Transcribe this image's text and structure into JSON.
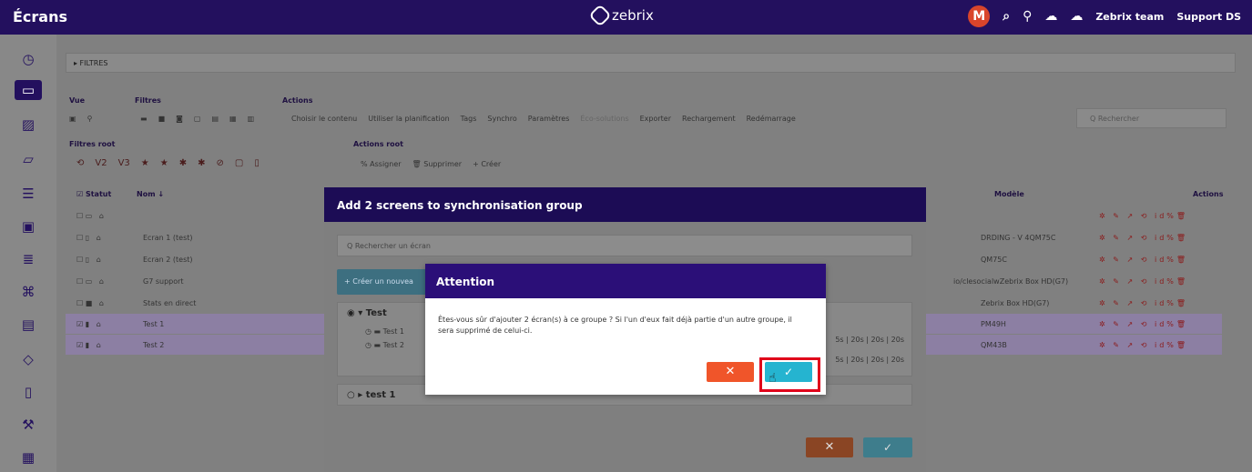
{
  "topbar": {
    "title": "Écrans",
    "brand": "zebrix",
    "avatar_letter": "M",
    "team": "Zebrix team",
    "support": "Support DS"
  },
  "main": {
    "filters_label": "▸ FILTRES",
    "vue_label": "Vue",
    "filtres_label": "Filtres",
    "actions_label": "Actions",
    "actions": [
      "Choisir le contenu",
      "Utiliser la planification",
      "Tags",
      "Synchro",
      "Paramètres",
      "Éco-solutions",
      "Exporter",
      "Rechargement",
      "Redémarrage"
    ],
    "search_placeholder": "Q  Rechercher",
    "filtres_root_label": "Filtres root",
    "filtres_root_items": [
      "⟲",
      "V2",
      "V3",
      "★",
      "★",
      "✱",
      "✱",
      "⊘",
      "▢",
      "▯"
    ],
    "actions_root_label": "Actions root",
    "actions_root": [
      "% Assigner",
      "🗑 Supprimer",
      "+ Créer"
    ],
    "col_statut": "Statut",
    "col_nom": "Nom ↓",
    "col_modele": "Modèle",
    "col_actions": "Actions",
    "rows": [
      {
        "name": "",
        "model": ""
      },
      {
        "name": "Ecran 1 (test)",
        "model": "DRDING - V 4QM75C"
      },
      {
        "name": "Ecran 2 (test)",
        "model": "QM75C"
      },
      {
        "name": "G7 support",
        "model": "io/clesocialwZebrix Box HD(G7)"
      },
      {
        "name": "Stats en direct",
        "model": "Zebrix Box HD(G7)"
      },
      {
        "name": "Test 1",
        "model": "PM49H"
      },
      {
        "name": "Test 2",
        "model": "QM43B"
      }
    ],
    "row_actions": "✲ ✎ ↗ ⟲ id%🗑"
  },
  "dialog_sync": {
    "title": "Add 2 screens to synchronisation group",
    "search_placeholder": "Q  Rechercher un écran",
    "create_button": "+ Créer un nouvea",
    "group1": {
      "name": "Test",
      "items": [
        "Test 1",
        "Test 2"
      ],
      "times1": "5s | 20s | 20s | 20s",
      "times2": "5s | 20s | 20s | 20s"
    },
    "group2": {
      "name": "test 1"
    },
    "cancel": "✕",
    "ok": "✓"
  },
  "dialog_attention": {
    "title": "Attention",
    "message": "Êtes-vous sûr d'ajouter 2 écran(s) à ce groupe ? Si l'un d'eux fait déjà partie d'un autre groupe, il sera supprimé de celui-ci.",
    "cancel": "✕",
    "ok": "✓"
  },
  "colors": {
    "topbar": "#23105e",
    "dialog_header": "#2b0f78",
    "cancel": "#f0552a",
    "ok": "#25b4d0",
    "highlight": "#e0001a"
  }
}
